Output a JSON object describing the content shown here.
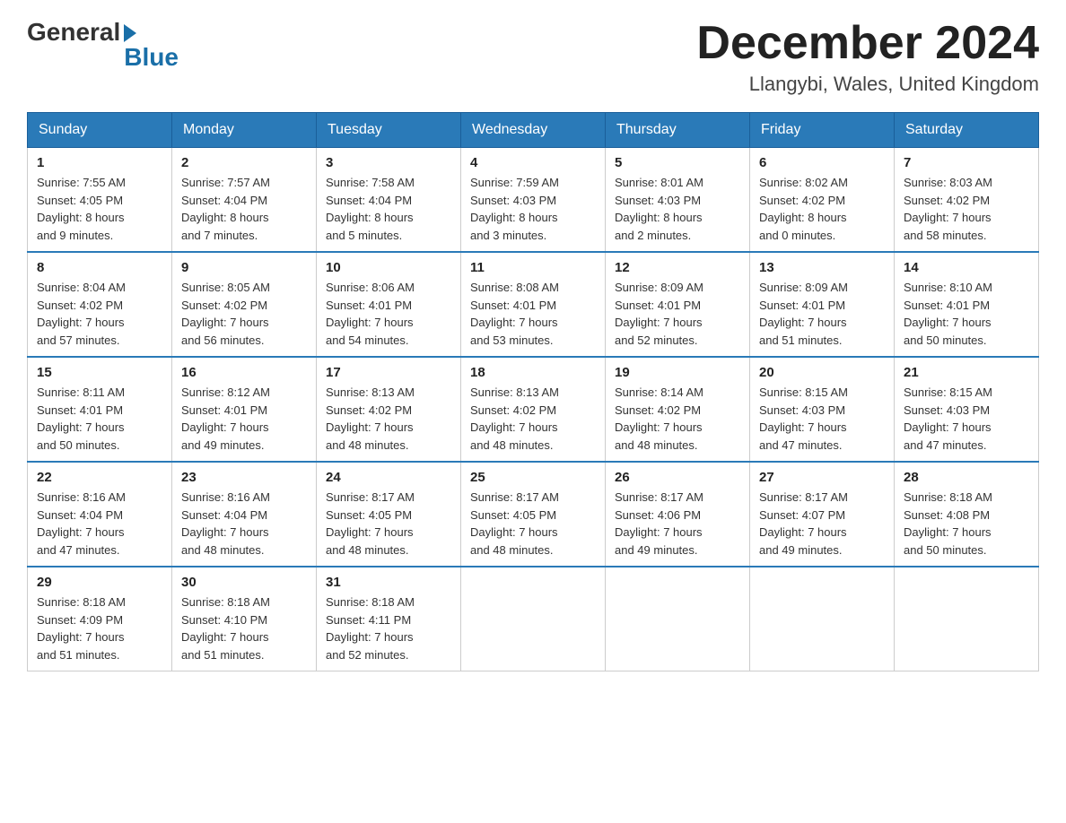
{
  "header": {
    "logo_general": "General",
    "logo_blue": "Blue",
    "title": "December 2024",
    "location": "Llangybi, Wales, United Kingdom"
  },
  "calendar": {
    "days_of_week": [
      "Sunday",
      "Monday",
      "Tuesday",
      "Wednesday",
      "Thursday",
      "Friday",
      "Saturday"
    ],
    "weeks": [
      [
        {
          "day": "1",
          "sunrise": "7:55 AM",
          "sunset": "4:05 PM",
          "daylight": "8 hours and 9 minutes."
        },
        {
          "day": "2",
          "sunrise": "7:57 AM",
          "sunset": "4:04 PM",
          "daylight": "8 hours and 7 minutes."
        },
        {
          "day": "3",
          "sunrise": "7:58 AM",
          "sunset": "4:04 PM",
          "daylight": "8 hours and 5 minutes."
        },
        {
          "day": "4",
          "sunrise": "7:59 AM",
          "sunset": "4:03 PM",
          "daylight": "8 hours and 3 minutes."
        },
        {
          "day": "5",
          "sunrise": "8:01 AM",
          "sunset": "4:03 PM",
          "daylight": "8 hours and 2 minutes."
        },
        {
          "day": "6",
          "sunrise": "8:02 AM",
          "sunset": "4:02 PM",
          "daylight": "8 hours and 0 minutes."
        },
        {
          "day": "7",
          "sunrise": "8:03 AM",
          "sunset": "4:02 PM",
          "daylight": "7 hours and 58 minutes."
        }
      ],
      [
        {
          "day": "8",
          "sunrise": "8:04 AM",
          "sunset": "4:02 PM",
          "daylight": "7 hours and 57 minutes."
        },
        {
          "day": "9",
          "sunrise": "8:05 AM",
          "sunset": "4:02 PM",
          "daylight": "7 hours and 56 minutes."
        },
        {
          "day": "10",
          "sunrise": "8:06 AM",
          "sunset": "4:01 PM",
          "daylight": "7 hours and 54 minutes."
        },
        {
          "day": "11",
          "sunrise": "8:08 AM",
          "sunset": "4:01 PM",
          "daylight": "7 hours and 53 minutes."
        },
        {
          "day": "12",
          "sunrise": "8:09 AM",
          "sunset": "4:01 PM",
          "daylight": "7 hours and 52 minutes."
        },
        {
          "day": "13",
          "sunrise": "8:09 AM",
          "sunset": "4:01 PM",
          "daylight": "7 hours and 51 minutes."
        },
        {
          "day": "14",
          "sunrise": "8:10 AM",
          "sunset": "4:01 PM",
          "daylight": "7 hours and 50 minutes."
        }
      ],
      [
        {
          "day": "15",
          "sunrise": "8:11 AM",
          "sunset": "4:01 PM",
          "daylight": "7 hours and 50 minutes."
        },
        {
          "day": "16",
          "sunrise": "8:12 AM",
          "sunset": "4:01 PM",
          "daylight": "7 hours and 49 minutes."
        },
        {
          "day": "17",
          "sunrise": "8:13 AM",
          "sunset": "4:02 PM",
          "daylight": "7 hours and 48 minutes."
        },
        {
          "day": "18",
          "sunrise": "8:13 AM",
          "sunset": "4:02 PM",
          "daylight": "7 hours and 48 minutes."
        },
        {
          "day": "19",
          "sunrise": "8:14 AM",
          "sunset": "4:02 PM",
          "daylight": "7 hours and 48 minutes."
        },
        {
          "day": "20",
          "sunrise": "8:15 AM",
          "sunset": "4:03 PM",
          "daylight": "7 hours and 47 minutes."
        },
        {
          "day": "21",
          "sunrise": "8:15 AM",
          "sunset": "4:03 PM",
          "daylight": "7 hours and 47 minutes."
        }
      ],
      [
        {
          "day": "22",
          "sunrise": "8:16 AM",
          "sunset": "4:04 PM",
          "daylight": "7 hours and 47 minutes."
        },
        {
          "day": "23",
          "sunrise": "8:16 AM",
          "sunset": "4:04 PM",
          "daylight": "7 hours and 48 minutes."
        },
        {
          "day": "24",
          "sunrise": "8:17 AM",
          "sunset": "4:05 PM",
          "daylight": "7 hours and 48 minutes."
        },
        {
          "day": "25",
          "sunrise": "8:17 AM",
          "sunset": "4:05 PM",
          "daylight": "7 hours and 48 minutes."
        },
        {
          "day": "26",
          "sunrise": "8:17 AM",
          "sunset": "4:06 PM",
          "daylight": "7 hours and 49 minutes."
        },
        {
          "day": "27",
          "sunrise": "8:17 AM",
          "sunset": "4:07 PM",
          "daylight": "7 hours and 49 minutes."
        },
        {
          "day": "28",
          "sunrise": "8:18 AM",
          "sunset": "4:08 PM",
          "daylight": "7 hours and 50 minutes."
        }
      ],
      [
        {
          "day": "29",
          "sunrise": "8:18 AM",
          "sunset": "4:09 PM",
          "daylight": "7 hours and 51 minutes."
        },
        {
          "day": "30",
          "sunrise": "8:18 AM",
          "sunset": "4:10 PM",
          "daylight": "7 hours and 51 minutes."
        },
        {
          "day": "31",
          "sunrise": "8:18 AM",
          "sunset": "4:11 PM",
          "daylight": "7 hours and 52 minutes."
        },
        null,
        null,
        null,
        null
      ]
    ]
  }
}
